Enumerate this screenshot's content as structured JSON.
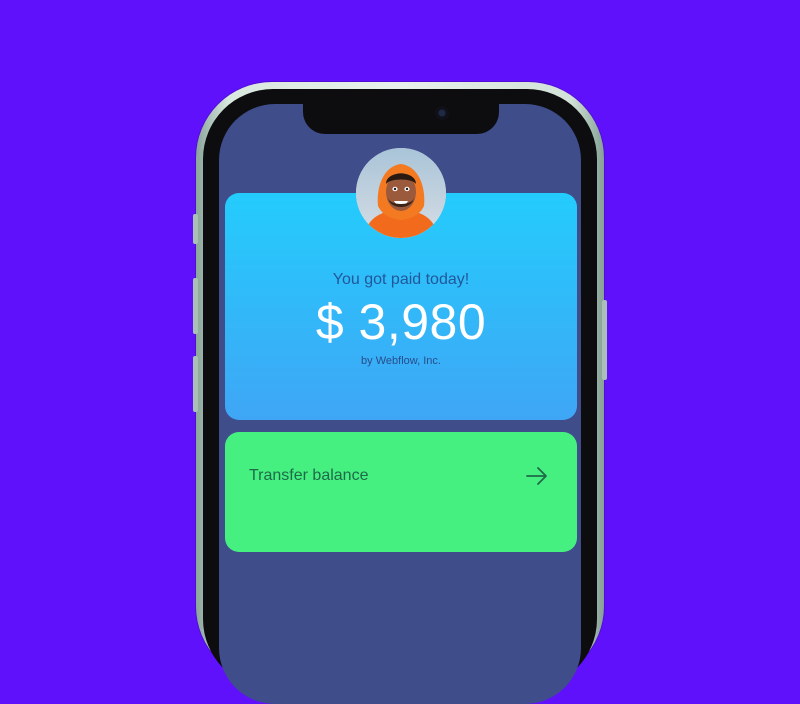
{
  "paid_card": {
    "title": "You got paid today!",
    "amount": "$ 3,980",
    "by": "by Webflow, Inc.",
    "gradient_top": "#24ccfc",
    "gradient_bottom": "#3fa6f6"
  },
  "transfer_card": {
    "label": "Transfer balance",
    "icon": "arrow-right-icon",
    "color": "#45f080"
  },
  "colors": {
    "background": "#6011fb",
    "screen": "#3f4d8b"
  }
}
